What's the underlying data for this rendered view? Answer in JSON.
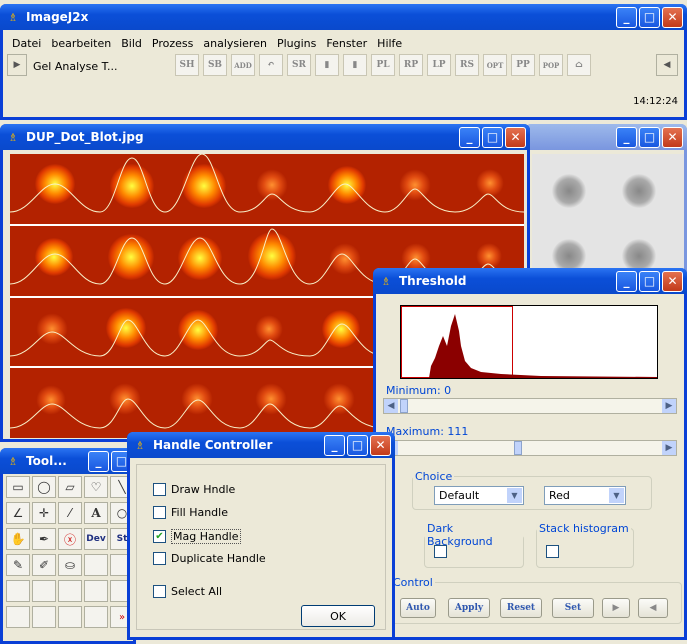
{
  "main": {
    "title": "ImageJ2x",
    "menus": [
      "Datei",
      "bearbeiten",
      "Bild",
      "Prozess",
      "analysieren",
      "Plugins",
      "Fenster",
      "Hilfe"
    ],
    "macro_label": "Gel Analyse T...",
    "tools": [
      "SH",
      "SB",
      "ADD",
      "↶",
      "SR",
      "▮",
      "▮",
      "PL",
      "RP",
      "LP",
      "RS",
      "OPT",
      "PP",
      "POP",
      "⌂"
    ],
    "clock": "14:12:24"
  },
  "image_window": {
    "title": "DUP_Dot_Blot.jpg"
  },
  "threshold": {
    "title": "Threshold",
    "minimum_label": "Minimum: 0",
    "maximum_label": "Maximum: 111",
    "choice_legend": "Choice",
    "method": "Default",
    "mode": "Red",
    "dark_bg_legend": "Dark Background",
    "stack_hist_legend": "Stack histogram",
    "control_legend": "Control",
    "buttons": [
      "Auto",
      "Apply",
      "Reset",
      "Set"
    ]
  },
  "tools_window": {
    "title": "Tool..."
  },
  "handle": {
    "title": "Handle Controller",
    "items": [
      {
        "label": "Draw Hndle",
        "checked": false
      },
      {
        "label": "Fill Handle",
        "checked": false
      },
      {
        "label": "Mag Handle",
        "checked": true
      },
      {
        "label": "Duplicate Handle",
        "checked": false
      }
    ],
    "select_all": "Select All",
    "ok": "OK"
  },
  "colors": {
    "titlebar": "#0b4fd8",
    "gel": "#b32200"
  }
}
